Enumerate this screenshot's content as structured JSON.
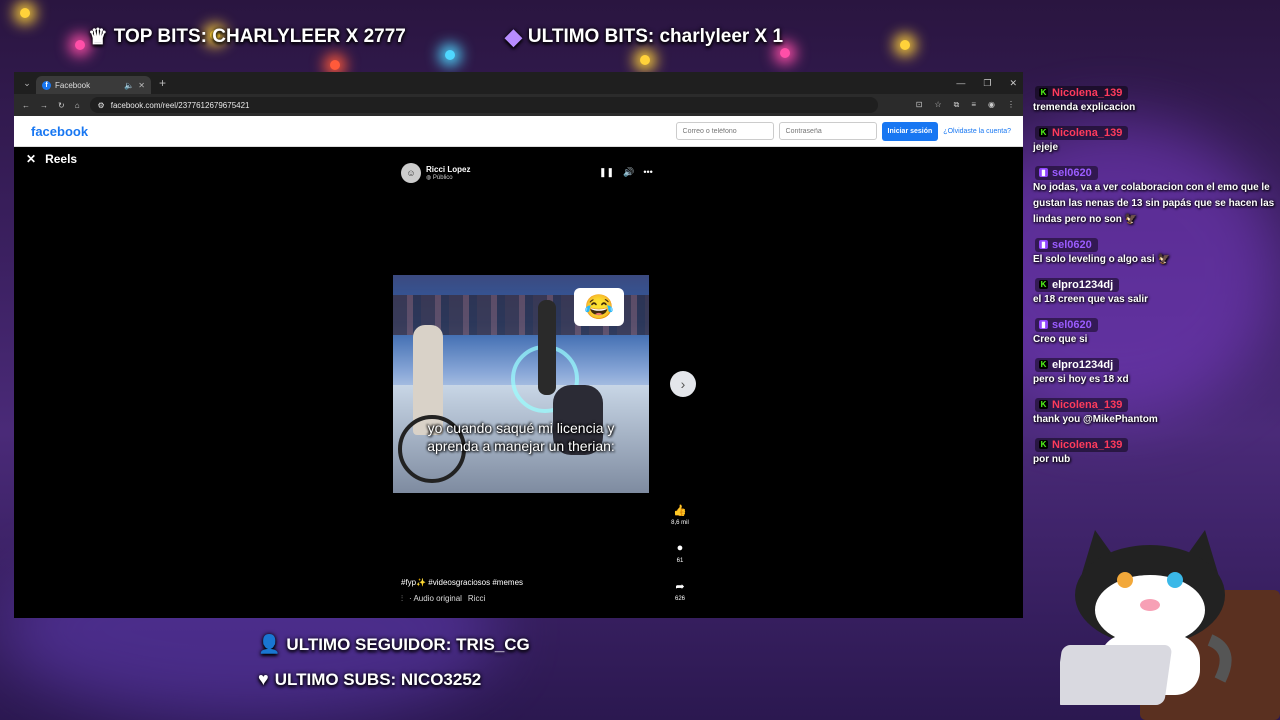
{
  "overlay": {
    "top_bits": "TOP BITS: CHARLYLEER X 2777",
    "last_bits": "ULTIMO BITS: charlyleer X 1",
    "last_follower": "ULTIMO SEGUIDOR: TRIS_CG",
    "last_subs": "ULTIMO SUBS: NICO3252"
  },
  "browser": {
    "tab_title": "Facebook",
    "url": "facebook.com/reel/2377612679675421"
  },
  "facebook": {
    "logo": "facebook",
    "email_placeholder": "Correo o teléfono",
    "password_placeholder": "Contraseña",
    "login_button": "Iniciar sesión",
    "forgot_link": "¿Olvidaste la cuenta?",
    "reels_title": "Reels",
    "author_name": "Ricci Lopez",
    "author_visibility": "Público",
    "video_caption": "yo cuando saqué mi licencia y aprenda a manejar un therian:",
    "likes": "8,6 mil",
    "comments": "61",
    "shares": "626",
    "hashtags": "#fyp✨ #videosgraciosos #memes",
    "audio_label": "· Audio original",
    "audio_author": "Ricci"
  },
  "chat": {
    "messages": [
      {
        "user": "Nicolena_139",
        "badge": "kick",
        "color": "#ff3b5c",
        "text": "tremenda explicacion"
      },
      {
        "user": "Nicolena_139",
        "badge": "kick",
        "color": "#ff3b5c",
        "text": "jejeje"
      },
      {
        "user": "sel0620",
        "badge": "twitch",
        "color": "#9b5cff",
        "text": "No jodas, va a ver colaboracion con el emo que le gustan las nenas de 13 sin papás que se hacen las lindas pero no son 🦅"
      },
      {
        "user": "sel0620",
        "badge": "twitch",
        "color": "#9b5cff",
        "text": "El solo leveling o algo asi 🦅"
      },
      {
        "user": "elpro1234dj",
        "badge": "kick",
        "color": "#ffffff",
        "text": "el 18 creen que vas salir"
      },
      {
        "user": "sel0620",
        "badge": "twitch",
        "color": "#9b5cff",
        "text": "Creo que si"
      },
      {
        "user": "elpro1234dj",
        "badge": "kick",
        "color": "#ffffff",
        "text": "pero si hoy es 18 xd"
      },
      {
        "user": "Nicolena_139",
        "badge": "kick",
        "color": "#ff3b5c",
        "text": "thank you @MikePhantom"
      },
      {
        "user": "Nicolena_139",
        "badge": "kick",
        "color": "#ff3b5c",
        "text": "por nub"
      }
    ]
  }
}
